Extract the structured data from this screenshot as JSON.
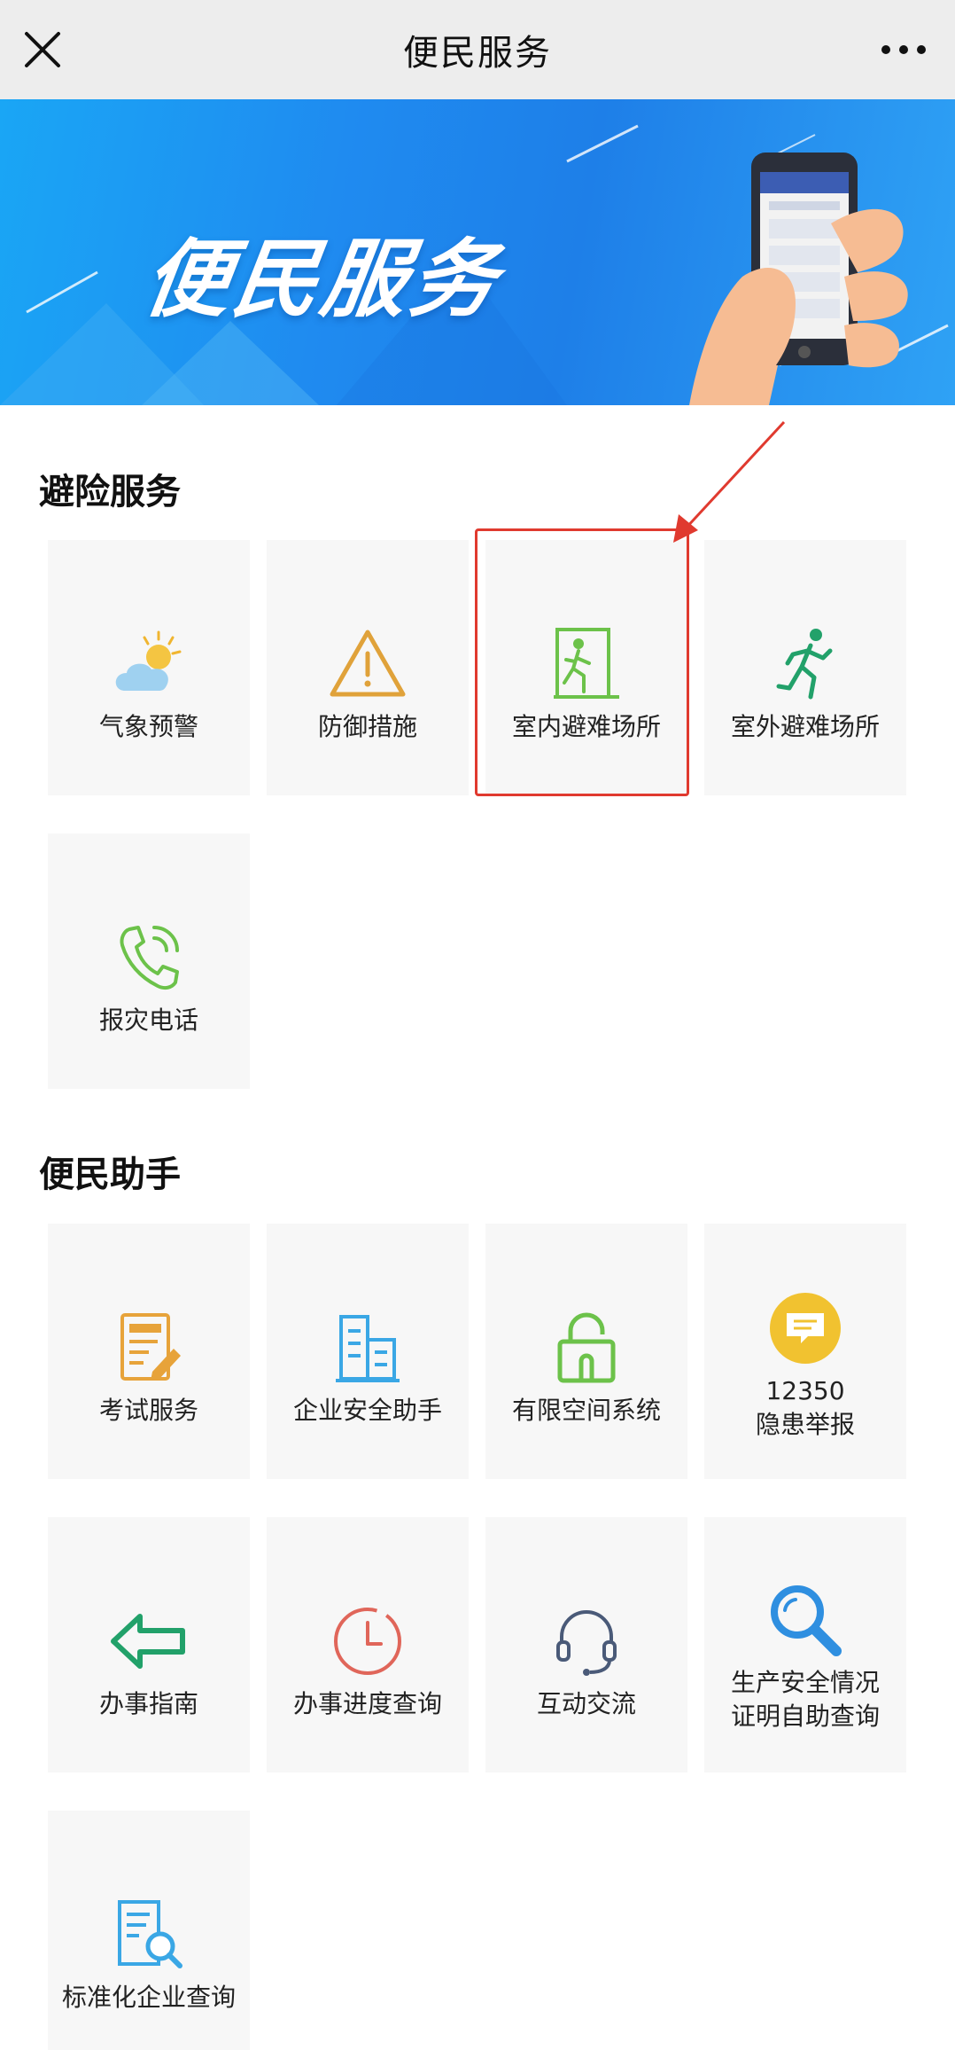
{
  "header": {
    "title": "便民服务",
    "close_icon": "close-icon",
    "more_icon": "more-icon"
  },
  "banner": {
    "title": "便民服务"
  },
  "sections": [
    {
      "title": "避险服务",
      "tiles": [
        {
          "label": "气象预警",
          "icon": "weather-icon"
        },
        {
          "label": "防御措施",
          "icon": "warning-icon"
        },
        {
          "label": "室内避难场所",
          "icon": "indoor-shelter-icon"
        },
        {
          "label": "室外避难场所",
          "icon": "running-person-icon"
        },
        {
          "label": "报灾电话",
          "icon": "phone-icon"
        }
      ]
    },
    {
      "title": "便民助手",
      "tiles": [
        {
          "label": "考试服务",
          "icon": "exam-icon"
        },
        {
          "label": "企业安全助手",
          "icon": "building-icon"
        },
        {
          "label": "有限空间系统",
          "icon": "lock-icon"
        },
        {
          "label_line1": "12350",
          "label_line2": "隐患举报",
          "icon": "chat-icon"
        },
        {
          "label": "办事指南",
          "icon": "arrow-left-icon"
        },
        {
          "label": "办事进度查询",
          "icon": "clock-icon"
        },
        {
          "label": "互动交流",
          "icon": "headset-icon"
        },
        {
          "label_line1": "生产安全情况",
          "label_line2": "证明自助查询",
          "icon": "search-icon"
        },
        {
          "label": "标准化企业查询",
          "icon": "document-search-icon"
        }
      ]
    }
  ],
  "colors": {
    "highlight": "#e03a2f",
    "green": "#6cc24a",
    "orange": "#e7a33a",
    "blue": "#3aa7e5",
    "red": "#e0665a",
    "yellow": "#f1c230"
  }
}
